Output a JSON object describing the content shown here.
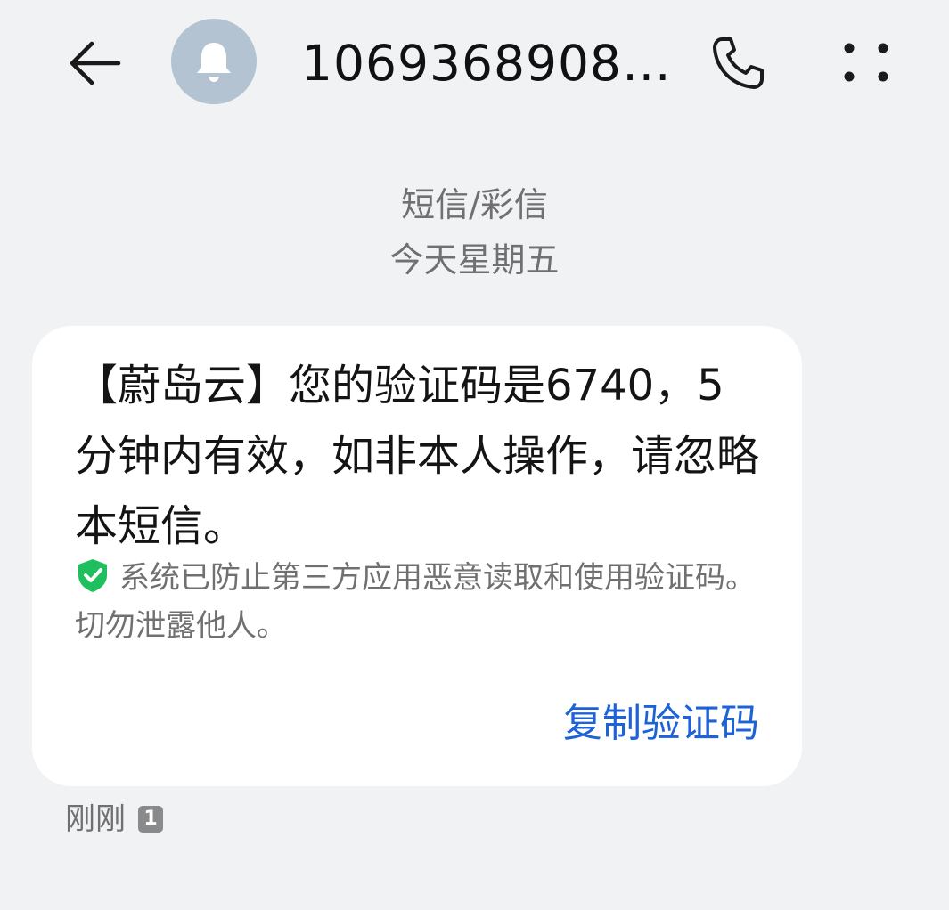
{
  "header": {
    "title": "1069368908…",
    "back_icon": "back-arrow-icon",
    "avatar_icon": "bell-icon",
    "call_icon": "phone-icon",
    "more_icon": "more-dots-icon"
  },
  "conversation": {
    "message_type": "短信/彩信",
    "date": "今天星期五"
  },
  "message": {
    "body": "【蔚岛云】您的验证码是6740，5分钟内有效，如非本人操作，请忽略本短信。",
    "security_note": "系统已防止第三方应用恶意读取和使用验证码。切勿泄露他人。",
    "copy_button": "复制验证码",
    "time": "刚刚",
    "sim": "1"
  },
  "colors": {
    "background": "#f1f2f4",
    "bubble": "#ffffff",
    "accent": "#1d62d7",
    "shield": "#1fbf5e",
    "avatar": "#b3c3d2"
  }
}
